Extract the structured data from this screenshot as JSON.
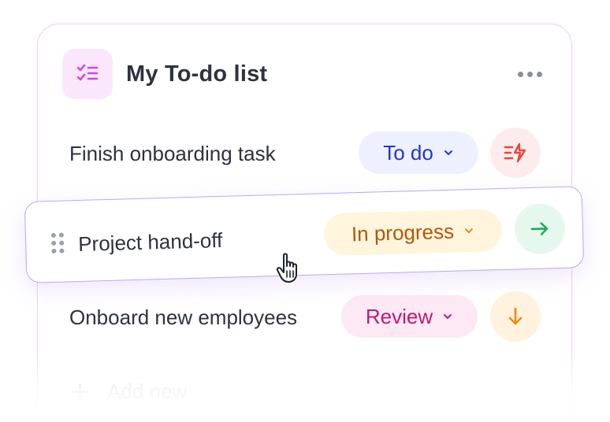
{
  "list": {
    "title": "My To-do list",
    "header_icon": "checklist-icon",
    "more_icon": "more-horizontal-icon"
  },
  "tasks": [
    {
      "text": "Finish onboarding task",
      "status": "To do",
      "status_color": "#2238c4",
      "status_bg": "#eef0fd",
      "action_icon": "priority-urgent-icon",
      "action_color": "#e8453c"
    },
    {
      "text": "Project hand-off",
      "status": "In progress",
      "status_color": "#b3560d",
      "status_bg": "#fff5dc",
      "action_icon": "arrow-right-icon",
      "action_color": "#1faa5c",
      "state": "dragging"
    },
    {
      "text": "Onboard new employees",
      "status": "Review",
      "status_color": "#c0177a",
      "status_bg": "#fde9f4",
      "action_icon": "arrow-down-icon",
      "action_color": "#f08a12"
    }
  ],
  "add_new": {
    "label": "Add new",
    "icon": "plus-icon"
  },
  "colors": {
    "accent": "#d04ad6",
    "card_border": "#efd3f4",
    "drag_border": "#b9a8f3"
  }
}
